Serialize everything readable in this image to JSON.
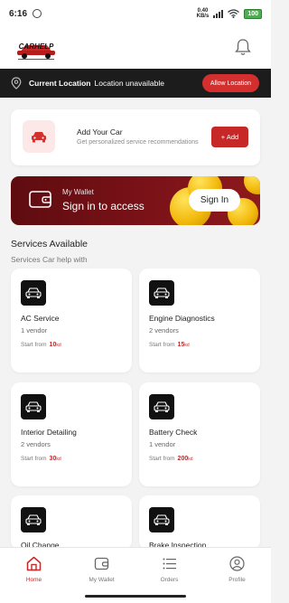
{
  "status_bar": {
    "time": "6:16",
    "net_speed": "0.40",
    "net_unit": "KB/s",
    "battery": "100"
  },
  "header": {
    "logo_alt": "CARHELP",
    "bell_icon": "bell-icon"
  },
  "location": {
    "label": "Current Location",
    "value": "Location unavailable",
    "allow_label": "Allow Location"
  },
  "add_car": {
    "title": "Add Your Car",
    "subtitle": "Get personalized service recommendations",
    "button_label": "+ Add",
    "icon": "car-icon"
  },
  "wallet": {
    "title": "My Wallet",
    "subtitle": "Sign in to access",
    "button_label": "Sign In",
    "icon": "wallet-icon"
  },
  "services": {
    "title": "Services Available",
    "subtitle": "Services Car help with",
    "start_prefix": "Start from",
    "currency": "kd",
    "items": [
      {
        "name": "AC Service",
        "vendors": "1 vendor",
        "price": "10"
      },
      {
        "name": "Engine Diagnostics",
        "vendors": "2 vendors",
        "price": "15"
      },
      {
        "name": "Interior Detailing",
        "vendors": "2 vendors",
        "price": "30"
      },
      {
        "name": "Battery Check",
        "vendors": "1 vendor",
        "price": "200"
      },
      {
        "name": "Oil Change",
        "vendors": "",
        "price": ""
      },
      {
        "name": "Brake Inspection",
        "vendors": "",
        "price": ""
      }
    ]
  },
  "nav": {
    "items": [
      {
        "label": "Home",
        "icon": "home-icon",
        "active": true
      },
      {
        "label": "My Wallet",
        "icon": "wallet-icon",
        "active": false
      },
      {
        "label": "Orders",
        "icon": "list-icon",
        "active": false
      },
      {
        "label": "Profile",
        "icon": "profile-icon",
        "active": false
      }
    ]
  },
  "colors": {
    "accent": "#c62828",
    "location_bar": "#1c1c1c",
    "wallet_bg": "#6f0f14"
  }
}
